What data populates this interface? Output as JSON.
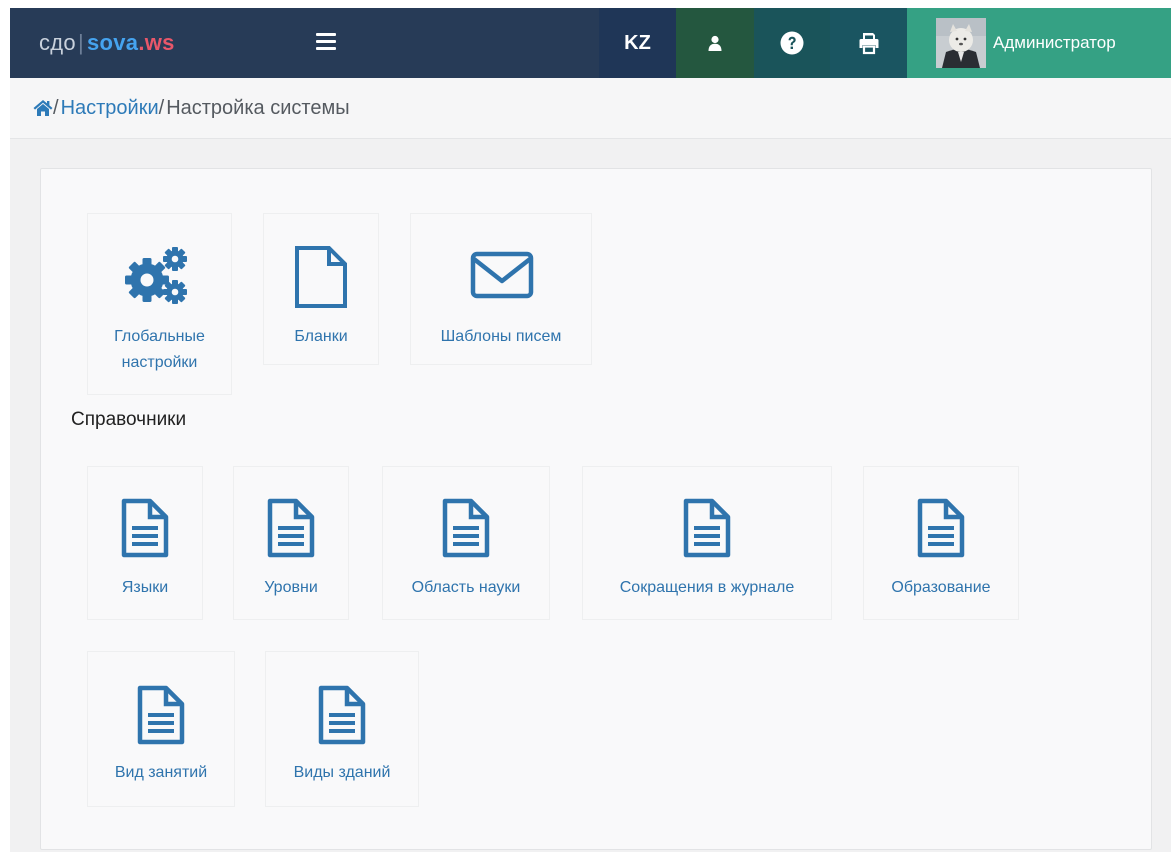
{
  "navbar": {
    "brand_cdo": "сдо",
    "brand_sep": "|",
    "brand_sova": "sova",
    "brand_ws": ".ws",
    "lang_label": "KZ",
    "user_name": "Администратор",
    "icons": {
      "menu": "hamburger-icon",
      "user": "user-icon",
      "help": "question-circle-icon",
      "print": "printer-icon",
      "avatar": "avatar-image"
    }
  },
  "breadcrumb": {
    "home_icon": "home-icon",
    "sep1": "/",
    "settings_link": "Настройки",
    "sep2": "/",
    "current": "Настройка системы"
  },
  "main": {
    "tiles": [
      {
        "label_line1": "Глобальные",
        "label_line2": "настройки",
        "icon": "gears-icon"
      },
      {
        "label": "Бланки",
        "icon": "file-icon"
      },
      {
        "label": "Шаблоны писем",
        "icon": "envelope-icon"
      }
    ],
    "directories_title": "Справочники",
    "directories": [
      {
        "label": "Языки",
        "icon": "file-text-icon"
      },
      {
        "label": "Уровни",
        "icon": "file-text-icon"
      },
      {
        "label": "Область науки",
        "icon": "file-text-icon"
      },
      {
        "label": "Сокращения в журнале",
        "icon": "file-text-icon"
      },
      {
        "label": "Образование",
        "icon": "file-text-icon"
      },
      {
        "label": "Вид занятий",
        "icon": "file-text-icon"
      },
      {
        "label": "Виды зданий",
        "icon": "file-text-icon"
      }
    ]
  },
  "colors": {
    "navbar_bg": "#273b57",
    "link": "#2f74ad",
    "icon": "#2f74ad",
    "admin_bg": "#35a184"
  }
}
